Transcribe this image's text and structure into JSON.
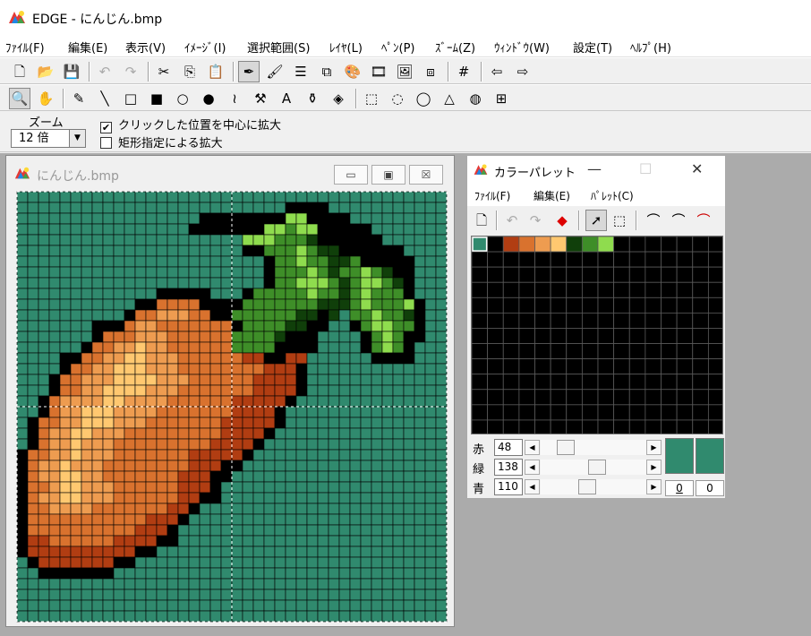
{
  "app": {
    "title": "EDGE - にんじん.bmp"
  },
  "menu": [
    "ﾌｧｲﾙ(F)",
    "編集(E)",
    "表示(V)",
    "ｲﾒｰｼﾞ(I)",
    "選択範囲(S)",
    "ﾚｲﾔ(L)",
    "ﾍﾟﾝ(P)",
    "ｽﾞｰﾑ(Z)",
    "ｳｨﾝﾄﾞｳ(W)",
    "設定(T)",
    "ﾍﾙﾌﾟ(H)"
  ],
  "toolbar1": [
    {
      "name": "new-file-icon",
      "glyph": "🗋"
    },
    {
      "name": "open-folder-icon",
      "glyph": "📂"
    },
    {
      "name": "save-icon",
      "glyph": "💾"
    },
    {
      "name": "undo-icon",
      "glyph": "↶",
      "dim": true
    },
    {
      "name": "redo-icon",
      "glyph": "↷",
      "dim": true
    },
    {
      "name": "cut-icon",
      "glyph": "✂"
    },
    {
      "name": "copy-icon",
      "glyph": "⎘"
    },
    {
      "name": "paste-icon",
      "glyph": "📋",
      "dim": true
    },
    {
      "name": "pen-mode-icon",
      "glyph": "✒",
      "pressed": true
    },
    {
      "name": "brush-mode-icon",
      "glyph": "🖌"
    },
    {
      "name": "layer-icon",
      "glyph": "☰"
    },
    {
      "name": "stamp-icon",
      "glyph": "⧉"
    },
    {
      "name": "palette-icon",
      "glyph": "🎨"
    },
    {
      "name": "film-icon",
      "glyph": "🎞"
    },
    {
      "name": "preview-icon",
      "glyph": "🖼"
    },
    {
      "name": "resize-icon",
      "glyph": "⧈"
    },
    {
      "name": "grid-icon",
      "glyph": "#"
    },
    {
      "name": "prev-image-icon",
      "glyph": "⇦"
    },
    {
      "name": "next-image-icon",
      "glyph": "⇨"
    }
  ],
  "toolbar2": [
    {
      "name": "zoom-tool-icon",
      "glyph": "🔍",
      "pressed": true
    },
    {
      "name": "hand-tool-icon",
      "glyph": "✋"
    },
    {
      "name": "pen-tool-icon",
      "glyph": "✎"
    },
    {
      "name": "line-tool-icon",
      "glyph": "╲"
    },
    {
      "name": "rect-tool-icon",
      "glyph": "□"
    },
    {
      "name": "filled-rect-tool-icon",
      "glyph": "■"
    },
    {
      "name": "ellipse-tool-icon",
      "glyph": "○"
    },
    {
      "name": "filled-ellipse-tool-icon",
      "glyph": "●"
    },
    {
      "name": "curve-tool-icon",
      "glyph": "≀"
    },
    {
      "name": "hammer-tool-icon",
      "glyph": "⚒"
    },
    {
      "name": "text-tool-icon",
      "glyph": "A"
    },
    {
      "name": "spray-tool-icon",
      "glyph": "⚱"
    },
    {
      "name": "fill-tool-icon",
      "glyph": "◈"
    },
    {
      "name": "rect-select-icon",
      "glyph": "⬚"
    },
    {
      "name": "ellipse-select-icon",
      "glyph": "◌"
    },
    {
      "name": "lasso-select-icon",
      "glyph": "◯"
    },
    {
      "name": "polygon-select-icon",
      "glyph": "△"
    },
    {
      "name": "color-select-icon",
      "glyph": "◍"
    },
    {
      "name": "transform-select-icon",
      "glyph": "⊞"
    }
  ],
  "zoom": {
    "label": "ズーム",
    "value": "12 倍",
    "center_label": "クリックした位置を中心に拡大",
    "center_checked": true,
    "rect_label": "矩形指定による拡大",
    "rect_checked": false
  },
  "image_window": {
    "title": "にんじん.bmp"
  },
  "image": {
    "palette": {
      "t": "#308a6e",
      "k": "#000000",
      "r": "#b13d12",
      "o": "#d9722e",
      "s": "#ee9c50",
      "y": "#ffc870",
      "d": "#103f0a",
      "g": "#3e8e28",
      "l": "#8fdc4e"
    },
    "rows": [
      "tttttttttttttttttttttttttttttttttttttttt",
      "tttttttttttttttttttttttttkkkkttttttttttt",
      "tttttttttttttttttkkkkkkkkllkkkkttttttttt",
      "ttttttttttttttttkkkkkkkllgllkkkkkttttttt",
      "tttttttttttttttttttttlllgggdkkkkkktttttt",
      "tttttttttttttttttttttkkggglgddkkkkkktttt",
      "tttttttttttttttttttttttkgglggddgkkkkkttt",
      "tttttttttttttttttttttttkggglgdgglgdkkttt",
      "tttttttttttttttttttttttkgglllgdgllgdkttt",
      "tttttttttttttkkkkktttkggggglggdglgggkttt",
      "tttttttttttkkooookkkkgggggggdddglggglktt",
      "ttttttttttkoosssookkggggggddkdtgglggdktt",
      "tttttttkkkossoooooookggggddkkttkgllggktt",
      "tttttttkooosssooooooggggdkkkttttkglgkktt",
      "ttttttkoossyssooooooggggkkkkttttkglgkttt",
      "ttttkkoossyysssoooooorrkkrrttttttkkkkttt",
      "ttttkoossyyysssoooooooorrrkttttttttttttt",
      "tttkoosssyyyysssoooooorrrrkttttttttttttt",
      "tttkoossyyyysssooooooorrrrkttttttttttttt",
      "ttkossssyyssssoooooorrrrrktttttttttttttt",
      "ttkossyyyssssooooooorrrrkttttttttttttttt",
      "tkoossyyysssooooooorrrrrkttttttttttttttt",
      "tkossyysssooooooooorrrrktttttttttttttttt",
      "tkossysssooooooooorrrrkttttttttttttttttt",
      "koossysssooooooorrrrrktttttttttttttttttt",
      "kossysssoooooooorrrkkttttttttttttttttttt",
      "kossyyssooooooorrrkktttttttttttttttttttt",
      "koosyysssoooooorrrkttttttttttttttttttttt",
      "kossyysssoooooorrkkttttttttttttttttttttt",
      "koossssooooooorrkttttttttttttttttttttttt",
      "kooooooooooorrrktttttttttttttttttttttttt",
      "koooooooooorrrkttttttttttttttttttttttttt",
      "krroooooorrrrkkttttttttttttttttttttttttt",
      "krrrrrrrrrrkkttttttttttttttttttttttttttt",
      "tkrrrrrrrkkttttttttttttttttttttttttttttt",
      "ttkkkkkkkttttttttttttttttttttttttttttttt",
      "tttttttttttttttttttttttttttttttttttttttt",
      "tttttttttttttttttttttttttttttttttttttttt",
      "tttttttttttttttttttttttttttttttttttttttt",
      "tttttttttttttttttttttttttttttttttttttttt"
    ]
  },
  "palette_window": {
    "title": "カラーパレット",
    "menu": [
      "ﾌｧｲﾙ(F)",
      "編集(E)",
      "ﾊﾟﾚｯﾄ(C)"
    ],
    "colors": [
      "#308a6e",
      "#000000",
      "#b13d12",
      "#d9722e",
      "#ee9c50",
      "#ffc870",
      "#103f0a",
      "#3e8e28",
      "#8fdc4e"
    ],
    "rgb": [
      {
        "label": "赤",
        "value": "48",
        "level": 48
      },
      {
        "label": "緑",
        "value": "138",
        "level": 138
      },
      {
        "label": "青",
        "value": "110",
        "level": 110
      }
    ],
    "current_color": "#308a6e",
    "index_left": "0",
    "index_right": "0"
  }
}
